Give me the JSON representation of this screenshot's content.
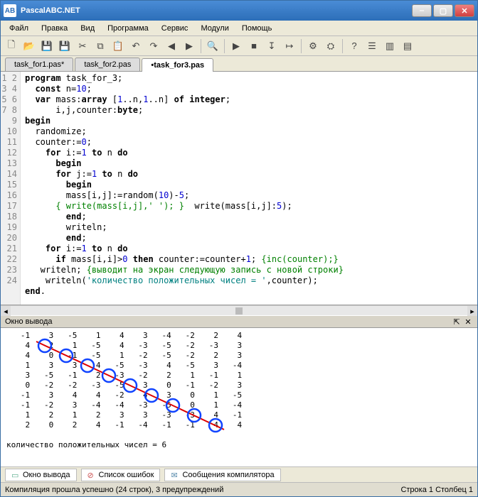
{
  "title": "PascalABC.NET",
  "menu": [
    "Файл",
    "Правка",
    "Вид",
    "Программа",
    "Сервис",
    "Модули",
    "Помощь"
  ],
  "toolbar_icons": [
    "new",
    "open",
    "save",
    "saveall",
    "cut",
    "copy",
    "paste",
    "undo",
    "redo",
    "nav-back",
    "nav-fwd",
    "sep",
    "find",
    "sep",
    "run",
    "stop",
    "step-into",
    "step-over",
    "sep",
    "compile",
    "build",
    "sep",
    "help",
    "opts",
    "win1",
    "win2"
  ],
  "tabs": [
    {
      "label": "task_for1.pas*",
      "active": false
    },
    {
      "label": "task_for2.pas",
      "active": false
    },
    {
      "label": "•task_for3.pas",
      "active": true
    }
  ],
  "code_lines": [
    {
      "n": 1,
      "segs": [
        {
          "c": "kw",
          "t": "program"
        },
        {
          "t": " task_for_3;"
        }
      ]
    },
    {
      "n": 2,
      "segs": [
        {
          "t": "  "
        },
        {
          "c": "kw",
          "t": "const"
        },
        {
          "t": " n="
        },
        {
          "c": "num",
          "t": "10"
        },
        {
          "t": ";"
        }
      ]
    },
    {
      "n": 3,
      "segs": [
        {
          "t": "  "
        },
        {
          "c": "kw",
          "t": "var"
        },
        {
          "t": " mass:"
        },
        {
          "c": "kw",
          "t": "array"
        },
        {
          "t": " ["
        },
        {
          "c": "num",
          "t": "1"
        },
        {
          "t": "..n,"
        },
        {
          "c": "num",
          "t": "1"
        },
        {
          "t": "..n] "
        },
        {
          "c": "kw",
          "t": "of"
        },
        {
          "t": " "
        },
        {
          "c": "typ",
          "t": "integer"
        },
        {
          "t": ";"
        }
      ]
    },
    {
      "n": 4,
      "segs": [
        {
          "t": "      i,j,counter:"
        },
        {
          "c": "typ",
          "t": "byte"
        },
        {
          "t": ";"
        }
      ]
    },
    {
      "n": 5,
      "segs": [
        {
          "c": "kw",
          "t": "begin"
        }
      ]
    },
    {
      "n": 6,
      "segs": [
        {
          "t": "  randomize;"
        }
      ]
    },
    {
      "n": 7,
      "segs": [
        {
          "t": "  counter:="
        },
        {
          "c": "num",
          "t": "0"
        },
        {
          "t": ";"
        }
      ]
    },
    {
      "n": 8,
      "segs": [
        {
          "t": "    "
        },
        {
          "c": "kw",
          "t": "for"
        },
        {
          "t": " i:="
        },
        {
          "c": "num",
          "t": "1"
        },
        {
          "t": " "
        },
        {
          "c": "kw",
          "t": "to"
        },
        {
          "t": " n "
        },
        {
          "c": "kw",
          "t": "do"
        }
      ]
    },
    {
      "n": 9,
      "segs": [
        {
          "t": "      "
        },
        {
          "c": "kw",
          "t": "begin"
        }
      ]
    },
    {
      "n": 10,
      "segs": [
        {
          "t": "      "
        },
        {
          "c": "kw",
          "t": "for"
        },
        {
          "t": " j:="
        },
        {
          "c": "num",
          "t": "1"
        },
        {
          "t": " "
        },
        {
          "c": "kw",
          "t": "to"
        },
        {
          "t": " n "
        },
        {
          "c": "kw",
          "t": "do"
        }
      ]
    },
    {
      "n": 11,
      "segs": [
        {
          "t": "        "
        },
        {
          "c": "kw",
          "t": "begin"
        }
      ]
    },
    {
      "n": 12,
      "segs": [
        {
          "t": "        mass[i,j]:=random("
        },
        {
          "c": "num",
          "t": "10"
        },
        {
          "t": ")-"
        },
        {
          "c": "num",
          "t": "5"
        },
        {
          "t": ";"
        }
      ]
    },
    {
      "n": 13,
      "segs": [
        {
          "t": "      "
        },
        {
          "c": "cmt",
          "t": "{ write(mass[i,j],' '); }"
        },
        {
          "t": "  write(mass[i,j]:"
        },
        {
          "c": "num",
          "t": "5"
        },
        {
          "t": ");"
        }
      ]
    },
    {
      "n": 14,
      "segs": [
        {
          "t": "        "
        },
        {
          "c": "kw",
          "t": "end"
        },
        {
          "t": ";"
        }
      ]
    },
    {
      "n": 15,
      "segs": [
        {
          "t": "        writeln;"
        }
      ]
    },
    {
      "n": 16,
      "segs": [
        {
          "t": "        "
        },
        {
          "c": "kw",
          "t": "end"
        },
        {
          "t": ";"
        }
      ]
    },
    {
      "n": 17,
      "segs": [
        {
          "t": ""
        }
      ]
    },
    {
      "n": 18,
      "segs": [
        {
          "t": "    "
        },
        {
          "c": "kw",
          "t": "for"
        },
        {
          "t": " i:="
        },
        {
          "c": "num",
          "t": "1"
        },
        {
          "t": " "
        },
        {
          "c": "kw",
          "t": "to"
        },
        {
          "t": " n "
        },
        {
          "c": "kw",
          "t": "do"
        }
      ]
    },
    {
      "n": 19,
      "segs": [
        {
          "t": "      "
        },
        {
          "c": "kw",
          "t": "if"
        },
        {
          "t": " mass[i,i]>"
        },
        {
          "c": "num",
          "t": "0"
        },
        {
          "t": " "
        },
        {
          "c": "kw",
          "t": "then"
        },
        {
          "t": " counter:=counter+"
        },
        {
          "c": "num",
          "t": "1"
        },
        {
          "t": "; "
        },
        {
          "c": "cmt",
          "t": "{inc(counter);}"
        }
      ]
    },
    {
      "n": 20,
      "segs": [
        {
          "t": ""
        }
      ]
    },
    {
      "n": 21,
      "segs": [
        {
          "t": "   writeln; "
        },
        {
          "c": "cmt",
          "t": "{выводит на экран следующую запись с новой строки}"
        }
      ]
    },
    {
      "n": 22,
      "segs": [
        {
          "t": "    writeln("
        },
        {
          "c": "str",
          "t": "'количество положительных чисел = '"
        },
        {
          "t": ",counter);"
        }
      ]
    },
    {
      "n": 23,
      "segs": [
        {
          "t": ""
        }
      ]
    },
    {
      "n": 24,
      "segs": [
        {
          "c": "kw",
          "t": "end"
        },
        {
          "t": "."
        }
      ]
    }
  ],
  "output_panel_title": "Окно вывода",
  "matrix": [
    [
      -1,
      3,
      -5,
      1,
      4,
      3,
      -4,
      -2,
      2,
      4
    ],
    [
      4,
      2,
      1,
      -5,
      4,
      -3,
      -5,
      -2,
      -3,
      3
    ],
    [
      4,
      0,
      -1,
      -5,
      1,
      -2,
      -5,
      -2,
      2,
      3
    ],
    [
      1,
      3,
      3,
      4,
      -5,
      -3,
      4,
      -5,
      3,
      -4
    ],
    [
      3,
      -5,
      -1,
      2,
      -3,
      -2,
      2,
      1,
      -1,
      1
    ],
    [
      0,
      -2,
      -2,
      -3,
      -5,
      3,
      0,
      -1,
      -2,
      3
    ],
    [
      -1,
      3,
      4,
      4,
      -2,
      4,
      3,
      0,
      1,
      -5
    ],
    [
      -1,
      -2,
      3,
      -4,
      -4,
      -3,
      -5,
      0,
      1,
      -4
    ],
    [
      1,
      2,
      1,
      2,
      3,
      3,
      -3,
      -3,
      4,
      -1
    ],
    [
      2,
      0,
      2,
      4,
      -1,
      -4,
      -1,
      -1,
      4,
      4
    ]
  ],
  "diag_circles": [
    2,
    -1,
    4,
    -3,
    3,
    3,
    0,
    4,
    4
  ],
  "output_summary": "количество положительных чисел = 6",
  "bottom_tabs": [
    {
      "label": "Окно вывода",
      "icon": "▭",
      "color": "#5a8"
    },
    {
      "label": "Список ошибок",
      "icon": "⊘",
      "color": "#c55"
    },
    {
      "label": "Сообщения компилятора",
      "icon": "✉",
      "color": "#58a"
    }
  ],
  "status_left": "Компиляция прошла успешно (24 строк), 3 предупреждений",
  "status_right": "Строка 1 Столбец 1"
}
